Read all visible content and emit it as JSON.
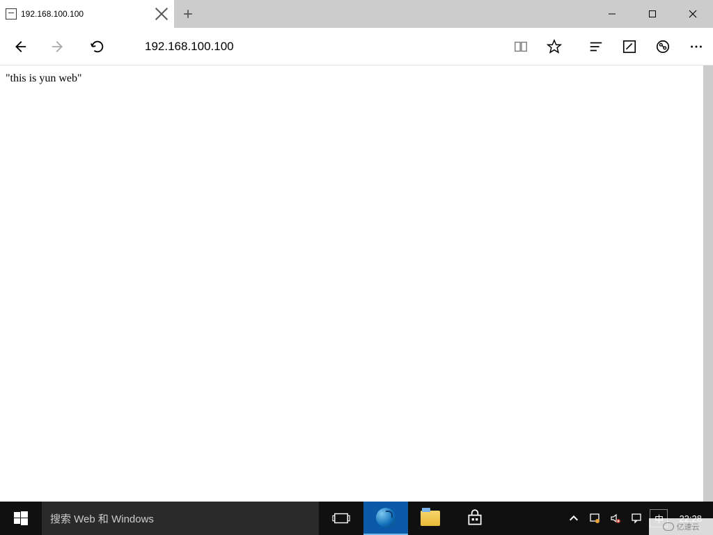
{
  "titlebar": {
    "tab_label": "192.168.100.100",
    "icons": {
      "tab_close": "close-icon",
      "new_tab": "plus-icon",
      "minimize": "minimize-icon",
      "maximize": "maximize-icon",
      "close": "close-icon"
    }
  },
  "toolbar": {
    "address_value": "192.168.100.100",
    "icons": {
      "back": "back-icon",
      "forward": "forward-icon",
      "refresh": "refresh-icon",
      "reading_view": "book-icon",
      "favorite": "star-icon",
      "hub": "lines-icon",
      "notes": "note-icon",
      "share": "share-icon",
      "more": "more-icon"
    }
  },
  "page": {
    "body_text": "\"this is yun web\""
  },
  "taskbar": {
    "search_placeholder": "搜索 Web 和 Windows",
    "ime_label": "中",
    "clock": "22:28",
    "icons": {
      "start": "windows-icon",
      "taskview": "taskview-icon",
      "edge": "edge-icon",
      "explorer": "folder-icon",
      "store": "store-icon",
      "tray_up": "chevron-up-icon",
      "notification_warn": "notification-warning-icon",
      "volume_muted": "volume-muted-icon",
      "action_center": "action-center-icon"
    }
  },
  "watermark": {
    "text": "亿速云"
  }
}
